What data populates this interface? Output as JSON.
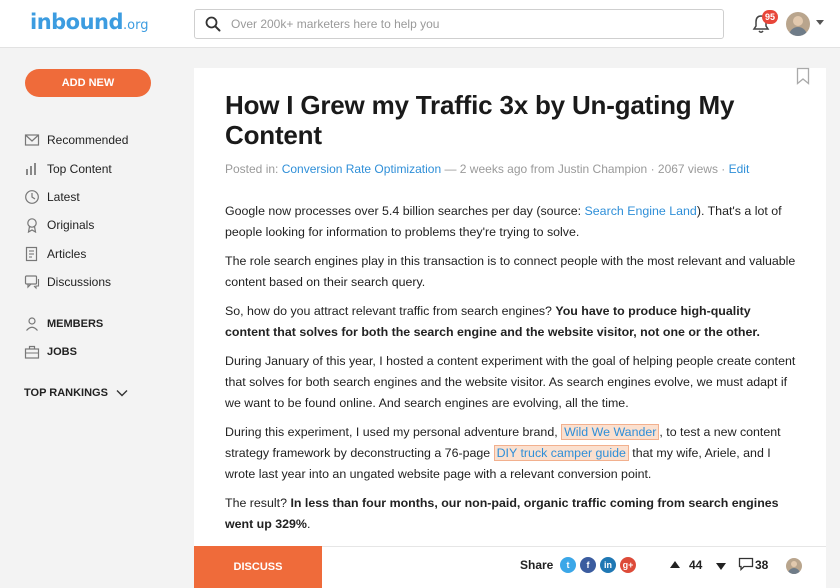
{
  "header": {
    "logo_main": "inbound",
    "logo_suffix": ".org",
    "search_placeholder": "Over 200k+ marketers here to help you",
    "notification_count": "95"
  },
  "sidebar": {
    "add_new_label": "ADD NEW",
    "items": [
      {
        "label": "Recommended",
        "icon": "envelope-icon"
      },
      {
        "label": "Top Content",
        "icon": "bar-chart-icon"
      },
      {
        "label": "Latest",
        "icon": "clock-icon"
      },
      {
        "label": "Originals",
        "icon": "original-badge-icon"
      },
      {
        "label": "Articles",
        "icon": "article-icon"
      },
      {
        "label": "Discussions",
        "icon": "discussion-icon"
      }
    ],
    "members_label": "MEMBERS",
    "jobs_label": "JOBS",
    "top_rankings_label": "TOP RANKINGS"
  },
  "article": {
    "title": "How I Grew my Traffic 3x by Un-gating My Content",
    "meta": {
      "posted_in": "Posted in:",
      "category": "Conversion Rate Optimization",
      "dash": " — ",
      "time_author": "2 weeks ago from Justin Champion",
      "sep1": " · ",
      "views": "2067 views",
      "sep2": " · ",
      "edit": "Edit"
    },
    "p1": {
      "text_a": "Google now processes over 5.4 billion searches per day (source: ",
      "link": "Search Engine Land",
      "text_b": "). That's a lot of people looking for information to problems they're trying to solve."
    },
    "p2": "The role search engines play in this transaction is to connect people with the most relevant and valuable content based on their search query.",
    "p3": {
      "text_a": "So, how do you attract relevant traffic from search engines? ",
      "bold": "You have to produce high-quality content that solves for both the search engine and the website visitor, not one or the other."
    },
    "p4": "During January of this year, I hosted a content experiment with the goal of helping people create content that solves for both search engines and the website visitor. As search engines evolve, we must adapt if we want to be found online. And search engines are evolving, all the time.",
    "p5": {
      "text_a": "During this experiment, I used my personal adventure brand, ",
      "link1": "Wild We Wander",
      "text_b": ", to test a new content strategy framework by deconstructing a 76-page ",
      "link2": "DIY truck camper guide",
      "text_c": " that my wife, Ariele, and I wrote last year into an ungated website page with a relevant conversion point."
    },
    "p6": {
      "text_a": "The result? ",
      "bold": "In less than four months, our non-paid, organic traffic coming from search engines went up 329%",
      "text_b": "."
    }
  },
  "bottom_bar": {
    "discuss_label": "DISCUSS",
    "share_label": "Share",
    "share_icons": [
      {
        "icon": "twitter-icon",
        "glyph": "t",
        "color": "#3ba7e8"
      },
      {
        "icon": "facebook-icon",
        "glyph": "f",
        "color": "#3b5c9f"
      },
      {
        "icon": "linkedin-icon",
        "glyph": "in",
        "color": "#1f78b4"
      },
      {
        "icon": "google-plus-icon",
        "glyph": "g+",
        "color": "#dd4b39"
      }
    ],
    "vote_count": "44",
    "comment_count": "38"
  },
  "colors": {
    "accent": "#ef6b3a",
    "link": "#2f8fd8",
    "logo": "#3c9ce0",
    "badge": "#e8463a"
  }
}
